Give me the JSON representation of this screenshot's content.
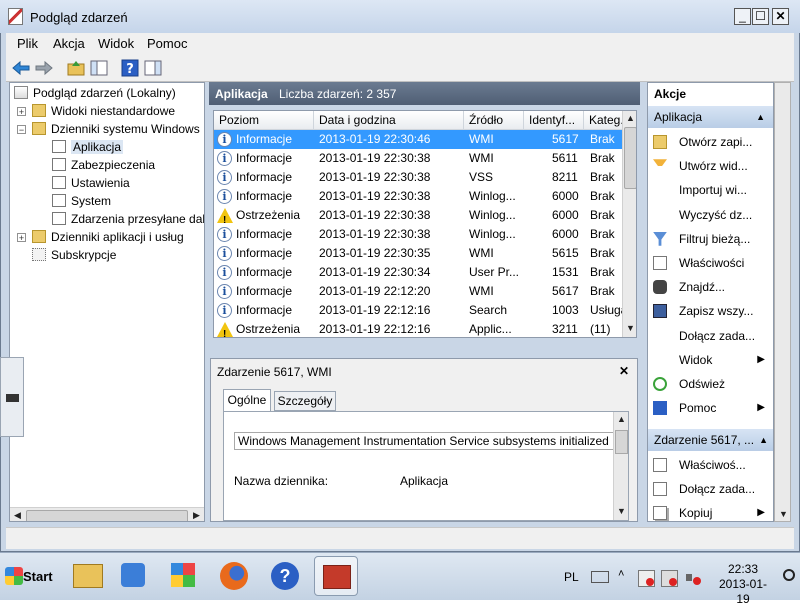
{
  "window": {
    "title": "Podgląd zdarzeń",
    "min": "_",
    "max": "☐",
    "close": "✕"
  },
  "menu": [
    "Plik",
    "Akcja",
    "Widok",
    "Pomoc"
  ],
  "tree": [
    {
      "label": "Podgląd zdarzeń (Lokalny)"
    },
    {
      "label": "Widoki niestandardowe"
    },
    {
      "label": "Dzienniki systemu Windows"
    },
    {
      "label": "Aplikacja"
    },
    {
      "label": "Zabezpieczenia"
    },
    {
      "label": "Ustawienia"
    },
    {
      "label": "System"
    },
    {
      "label": "Zdarzenia przesyłane dale"
    },
    {
      "label": "Dzienniki aplikacji i usług"
    },
    {
      "label": "Subskrypcje"
    }
  ],
  "center": {
    "title": "Aplikacja",
    "count": "Liczba zdarzeń: 2 357"
  },
  "columns": [
    "Poziom",
    "Data i godzina",
    "Źródło",
    "Identyf...",
    "Kateg..."
  ],
  "rows": [
    {
      "level": "Informacje",
      "date": "2013-01-19 22:30:46",
      "source": "WMI",
      "id": "5617",
      "cat": "Brak",
      "warn": false
    },
    {
      "level": "Informacje",
      "date": "2013-01-19 22:30:38",
      "source": "WMI",
      "id": "5611",
      "cat": "Brak",
      "warn": false
    },
    {
      "level": "Informacje",
      "date": "2013-01-19 22:30:38",
      "source": "VSS",
      "id": "8211",
      "cat": "Brak",
      "warn": false
    },
    {
      "level": "Informacje",
      "date": "2013-01-19 22:30:38",
      "source": "Winlog...",
      "id": "6000",
      "cat": "Brak",
      "warn": false
    },
    {
      "level": "Ostrzeżenia",
      "date": "2013-01-19 22:30:38",
      "source": "Winlog...",
      "id": "6000",
      "cat": "Brak",
      "warn": true
    },
    {
      "level": "Informacje",
      "date": "2013-01-19 22:30:38",
      "source": "Winlog...",
      "id": "6000",
      "cat": "Brak",
      "warn": false
    },
    {
      "level": "Informacje",
      "date": "2013-01-19 22:30:35",
      "source": "WMI",
      "id": "5615",
      "cat": "Brak",
      "warn": false
    },
    {
      "level": "Informacje",
      "date": "2013-01-19 22:30:34",
      "source": "User Pr...",
      "id": "1531",
      "cat": "Brak",
      "warn": false
    },
    {
      "level": "Informacje",
      "date": "2013-01-19 22:12:20",
      "source": "WMI",
      "id": "5617",
      "cat": "Brak",
      "warn": false
    },
    {
      "level": "Informacje",
      "date": "2013-01-19 22:12:16",
      "source": "Search",
      "id": "1003",
      "cat": "Usługa",
      "warn": false
    },
    {
      "level": "Ostrzeżenia",
      "date": "2013-01-19 22:12:16",
      "source": "Applic...",
      "id": "3211",
      "cat": "(11)",
      "warn": true
    }
  ],
  "detail": {
    "title": "Zdarzenie 5617, WMI",
    "close": "✕",
    "tab_general": "Ogólne",
    "tab_details": "Szczegóły",
    "message": "Windows Management Instrumentation Service subsystems initialized",
    "log_label": "Nazwa dziennika:",
    "log_value": "Aplikacja"
  },
  "actions": {
    "header": "Akcje",
    "section1": "Aplikacja",
    "items1": [
      {
        "label": "Otwórz zapi...",
        "icon": "folder-open-icon",
        "arrow": ""
      },
      {
        "label": "Utwórz wid...",
        "icon": "filter-create-icon",
        "arrow": ""
      },
      {
        "label": "Importuj wi...",
        "icon": "",
        "arrow": ""
      },
      {
        "label": "Wyczyść dz...",
        "icon": "",
        "arrow": ""
      },
      {
        "label": "Filtruj bieżą...",
        "icon": "filter-icon",
        "arrow": ""
      },
      {
        "label": "Właściwości",
        "icon": "properties-icon",
        "arrow": ""
      },
      {
        "label": "Znajdź...",
        "icon": "binoculars-icon",
        "arrow": ""
      },
      {
        "label": "Zapisz wszy...",
        "icon": "save-icon",
        "arrow": ""
      },
      {
        "label": "Dołącz zada...",
        "icon": "",
        "arrow": ""
      },
      {
        "label": "Widok",
        "icon": "",
        "arrow": "▶"
      },
      {
        "label": "Odśwież",
        "icon": "refresh-icon",
        "arrow": ""
      },
      {
        "label": "Pomoc",
        "icon": "help-icon",
        "arrow": "▶"
      }
    ],
    "section2": "Zdarzenie 5617, ...",
    "items2": [
      {
        "label": "Właściwoś...",
        "icon": "properties-icon",
        "arrow": ""
      },
      {
        "label": "Dołącz zada...",
        "icon": "task-icon",
        "arrow": ""
      },
      {
        "label": "Kopiuj",
        "icon": "copy-icon",
        "arrow": "▶"
      }
    ]
  },
  "taskbar": {
    "start": "Start",
    "lang": "PL",
    "time": "22:33",
    "date": "2013-01-19"
  }
}
